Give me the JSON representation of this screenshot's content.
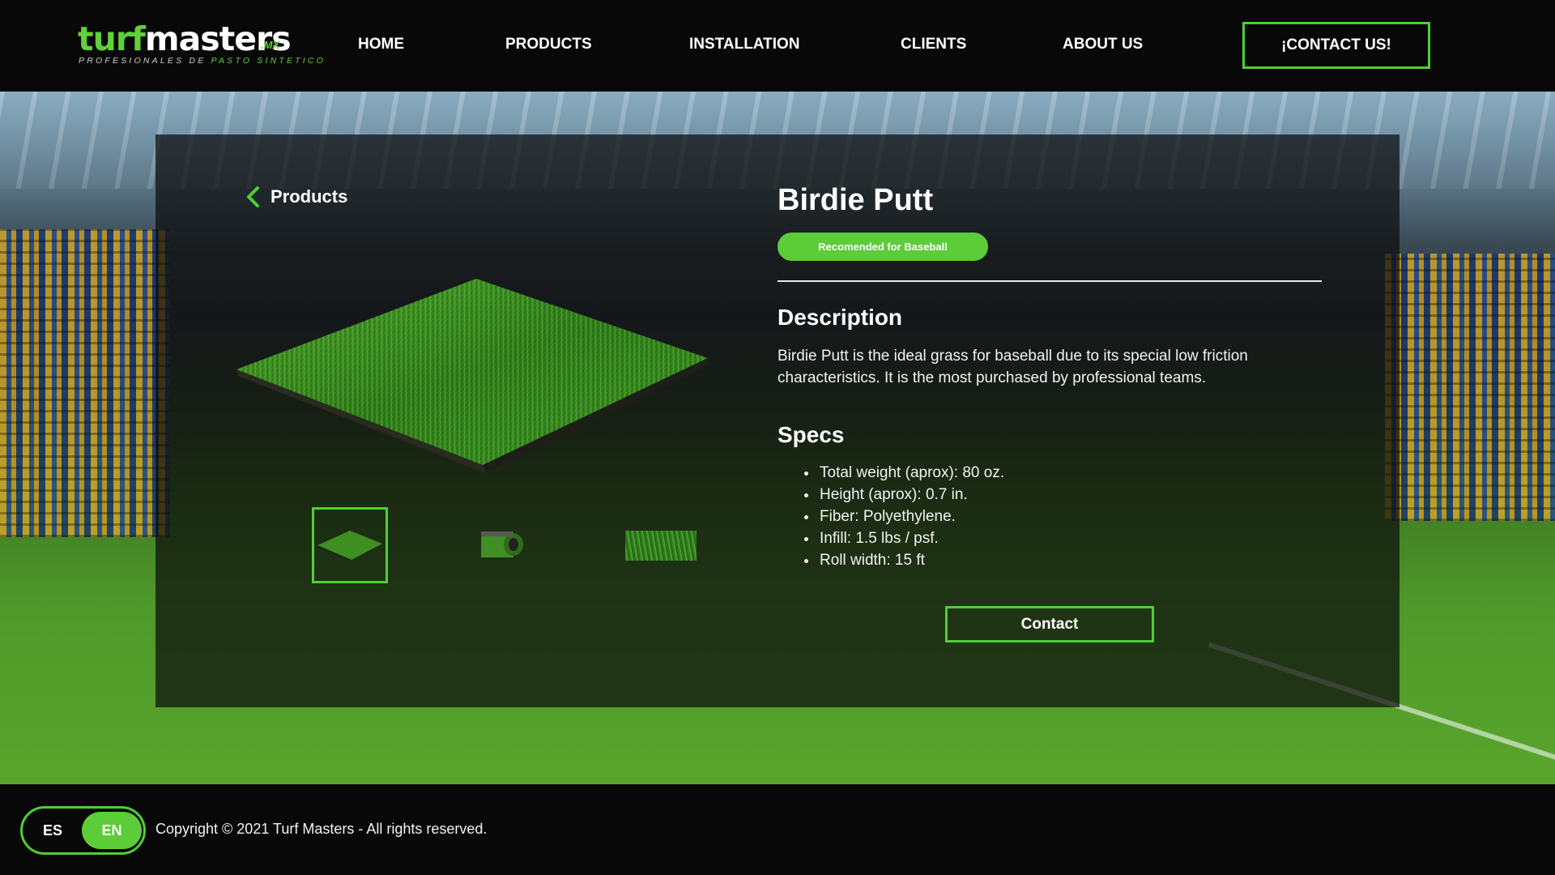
{
  "header": {
    "logo": {
      "word_turf": "turf",
      "word_masters": "masters",
      "tld": ".MX",
      "tagline_a": "PROFESIONALES DE ",
      "tagline_b": "PASTO SINTETICO"
    },
    "nav": [
      "HOME",
      "PRODUCTS",
      "INSTALLATION",
      "CLIENTS",
      "ABOUT US"
    ],
    "cta": "¡CONTACT US!"
  },
  "product": {
    "back_label": "Products",
    "name": "Birdie Putt",
    "badge": "Recomended for Baseball",
    "description_heading": "Description",
    "description": "Birdie Putt is the ideal grass for baseball due to its special low friction characteristics. It is the most purchased by professional teams.",
    "specs_heading": "Specs",
    "specs": [
      "Total weight (aprox): 80 oz.",
      "Height (aprox): 0.7 in.",
      "Fiber: Polyethylene.",
      "Infill: 1.5 lbs / psf.",
      "Roll width: 15 ft"
    ],
    "contact_button": "Contact"
  },
  "footer": {
    "lang_es": "ES",
    "lang_en": "EN",
    "copyright": "Copyright © 2021 Turf Masters - All rights reserved."
  },
  "colors": {
    "accent": "#5ccc38",
    "header_bg": "#080808"
  }
}
